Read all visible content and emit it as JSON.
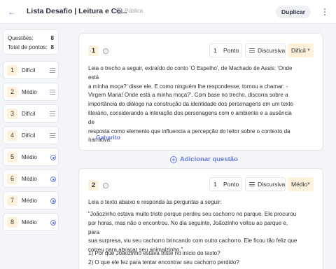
{
  "header": {
    "back_icon": "arrow-left-icon",
    "title": "Lista Desafio | Leitura e Co...",
    "visibility": "Pública",
    "duplicate_label": "Duplicar",
    "more_icon": "kebab-menu-icon"
  },
  "summary": {
    "questions_label": "Questões:",
    "questions_value": "8",
    "points_label": "Total de pontos:",
    "points_value": "8"
  },
  "sidebar": {
    "items": [
      {
        "number": "1",
        "level": "Difícil",
        "icon": "text-lines-icon"
      },
      {
        "number": "2",
        "level": "Médio",
        "icon": "text-lines-icon"
      },
      {
        "number": "3",
        "level": "Difícil",
        "icon": "text-lines-icon"
      },
      {
        "number": "4",
        "level": "Difícil",
        "icon": "text-lines-icon"
      },
      {
        "number": "5",
        "level": "Médio",
        "icon": "radio-icon"
      },
      {
        "number": "6",
        "level": "Médio",
        "icon": "radio-icon"
      },
      {
        "number": "7",
        "level": "Médio",
        "icon": "radio-icon"
      },
      {
        "number": "8",
        "level": "Médio",
        "icon": "radio-icon"
      }
    ]
  },
  "questions": [
    {
      "number": "1",
      "points_value": "1",
      "points_label": "Ponto",
      "type": "Discursiva",
      "difficulty": "Difícil",
      "lines": [
        "Leia o trecho a seguir, extraído do conto 'O Espelho', de Machado de Assis: 'Onde está",
        "a minha moça?' disse ele. E como ninguém lhe respondesse, tornou a chamar: -",
        "Virgem Maria! Onde está a minha moça?'. Com base no trecho, discorra sobre a",
        "importância do diálogo na construção da identidade dos personagens em um texto",
        "literário, considerando a interação dos personagens com o ambiente e a ausência de",
        "resposta como elemento que influencia a percepção do leitor sobre o contexto da",
        "narrativa."
      ],
      "answer_label": "Gabarito"
    },
    {
      "number": "2",
      "points_value": "1",
      "points_label": "Ponto",
      "type": "Discursiva",
      "difficulty": "Médio",
      "intro": "Leia o texto abaixo e responda às perguntas a seguir:",
      "lines": [
        "\"Joãozinho estava muito triste porque perdeu seu cachorro no parque. Ele procurou",
        "por horas, mas não o encontrou. No dia seguinte, Joãozinho voltou ao parque e, para",
        "sua surpresa, viu seu cachorro brincando com outro cachorro. Ele ficou tão feliz que",
        "correu para abraçar seu animalzinho.\""
      ],
      "questions": [
        "1) Por que Joãozinho estava triste no início do texto?",
        "2) O que ele fez para tentar encontrar seu cachorro perdido?"
      ]
    }
  ],
  "add_question_label": "Adicionar questão",
  "colors": {
    "accent": "#6b7ddc",
    "badge": "#fdf1dc"
  }
}
